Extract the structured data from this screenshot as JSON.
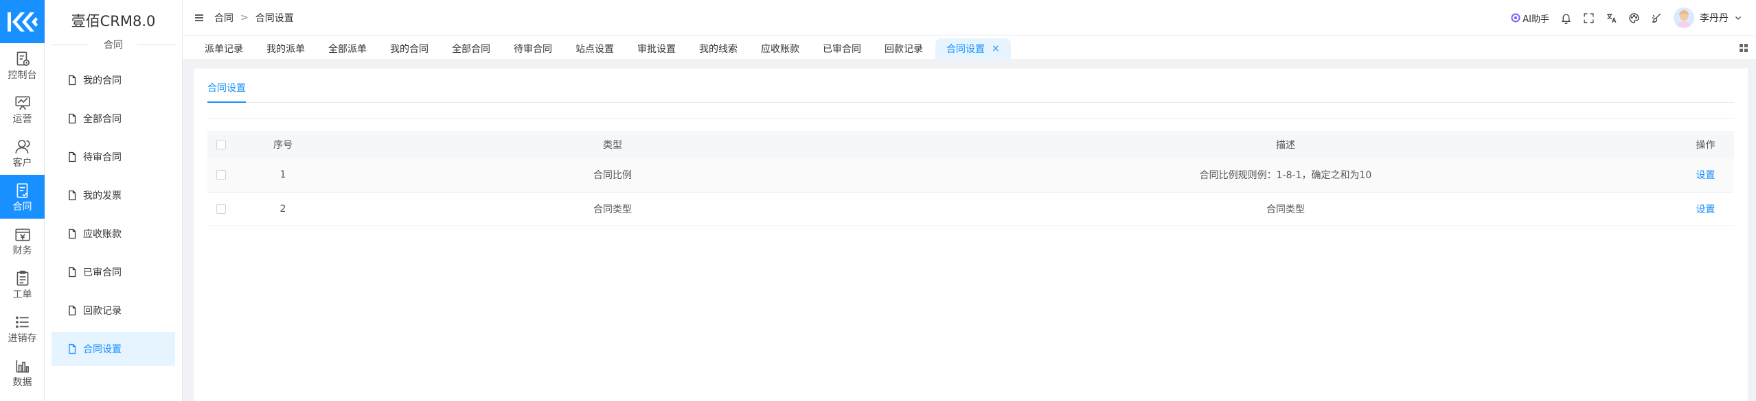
{
  "brand": {
    "name": "壹佰CRM8.0"
  },
  "rail": [
    {
      "label": "控制台",
      "icon": "dashboard-icon"
    },
    {
      "label": "运营",
      "icon": "operations-chart-icon"
    },
    {
      "label": "客户",
      "icon": "customer-icon"
    },
    {
      "label": "合同",
      "icon": "contract-icon",
      "active": true
    },
    {
      "label": "财务",
      "icon": "finance-icon"
    },
    {
      "label": "工单",
      "icon": "work-order-icon"
    },
    {
      "label": "进销存",
      "icon": "inventory-list-icon"
    },
    {
      "label": "数据",
      "icon": "data-bar-icon"
    }
  ],
  "subnav": {
    "section_title": "合同",
    "items": [
      {
        "label": "我的合同"
      },
      {
        "label": "全部合同"
      },
      {
        "label": "待审合同"
      },
      {
        "label": "我的发票"
      },
      {
        "label": "应收账款"
      },
      {
        "label": "已审合同"
      },
      {
        "label": "回款记录"
      },
      {
        "label": "合同设置",
        "active": true
      }
    ]
  },
  "header": {
    "breadcrumb": [
      "合同",
      "合同设置"
    ],
    "separator": ">",
    "ai_label": "AI助手",
    "user_name": "李丹丹"
  },
  "tabs": [
    {
      "label": "派单记录"
    },
    {
      "label": "我的派单"
    },
    {
      "label": "全部派单"
    },
    {
      "label": "我的合同"
    },
    {
      "label": "全部合同"
    },
    {
      "label": "待审合同"
    },
    {
      "label": "站点设置"
    },
    {
      "label": "审批设置"
    },
    {
      "label": "我的线索"
    },
    {
      "label": "应收账款"
    },
    {
      "label": "已审合同"
    },
    {
      "label": "回款记录"
    },
    {
      "label": "合同设置",
      "active": true,
      "close": "×"
    }
  ],
  "content": {
    "inner_tab": "合同设置",
    "table": {
      "columns": [
        "序号",
        "类型",
        "描述",
        "操作"
      ],
      "rows": [
        {
          "index": "1",
          "type": "合同比例",
          "desc": "合同比例规则例：1-8-1，确定之和为10",
          "action": "设置"
        },
        {
          "index": "2",
          "type": "合同类型",
          "desc": "合同类型",
          "action": "设置"
        }
      ]
    }
  },
  "colors": {
    "accent": "#1890ff",
    "active_bg": "#e6f4ff"
  }
}
